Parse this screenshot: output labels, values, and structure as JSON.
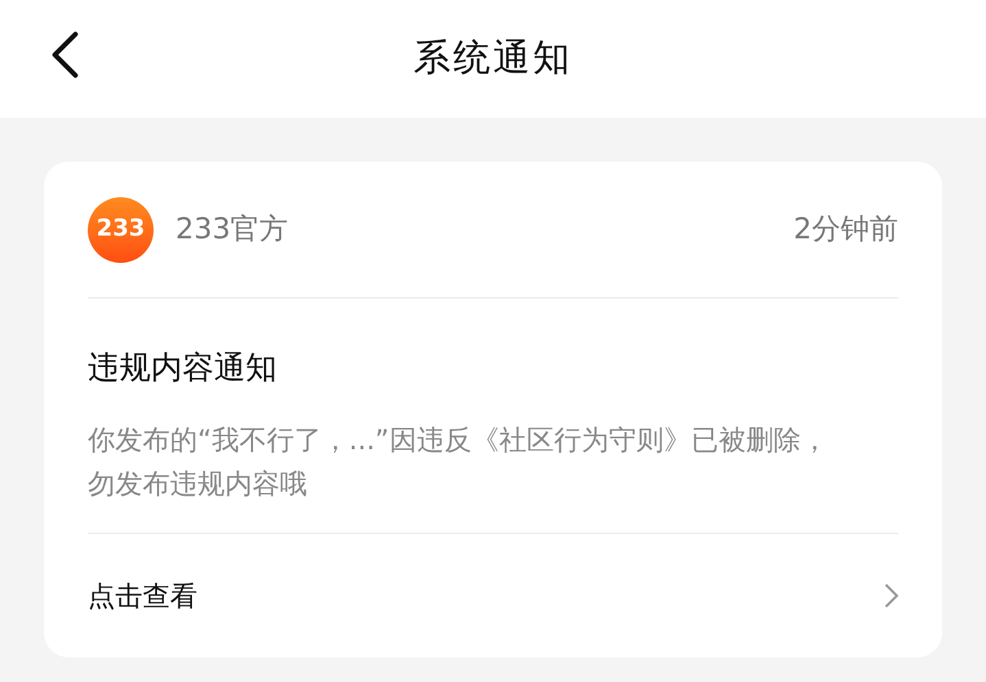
{
  "header": {
    "title": "系统通知"
  },
  "notification": {
    "logo_text": "233",
    "sender": "233官方",
    "time": "2分钟前",
    "title": "违规内容通知",
    "body": "你发布的“我不行了，...”因违反《社区行为守则》已被删除，勿发布违规内容哦",
    "action": "点击查看"
  }
}
